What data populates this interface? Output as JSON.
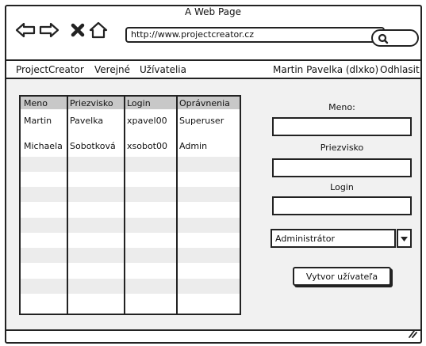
{
  "window": {
    "title": "A Web Page"
  },
  "browser": {
    "url": "http://www.projectcreator.cz"
  },
  "menu": {
    "app_name": "ProjectCreator",
    "public_label": "Verejné",
    "users_label": "Užívatelia",
    "current_user": "Martin Pavelka (dlxko)",
    "logout_label": "Odhlasit"
  },
  "table": {
    "headers": [
      "Meno",
      "Priezvisko",
      "Login",
      "Oprávnenia"
    ],
    "rows": [
      [
        "Martin",
        "Pavelka",
        "xpavel00",
        "Superuser"
      ],
      [
        "Michaela",
        "Sobotková",
        "xsobot00",
        "Admin"
      ]
    ]
  },
  "form": {
    "first_name_label": "Meno:",
    "last_name_label": "Priezvisko",
    "login_label": "Login",
    "role_value": "Administrátor",
    "create_button": "Vytvor užívateľa"
  }
}
